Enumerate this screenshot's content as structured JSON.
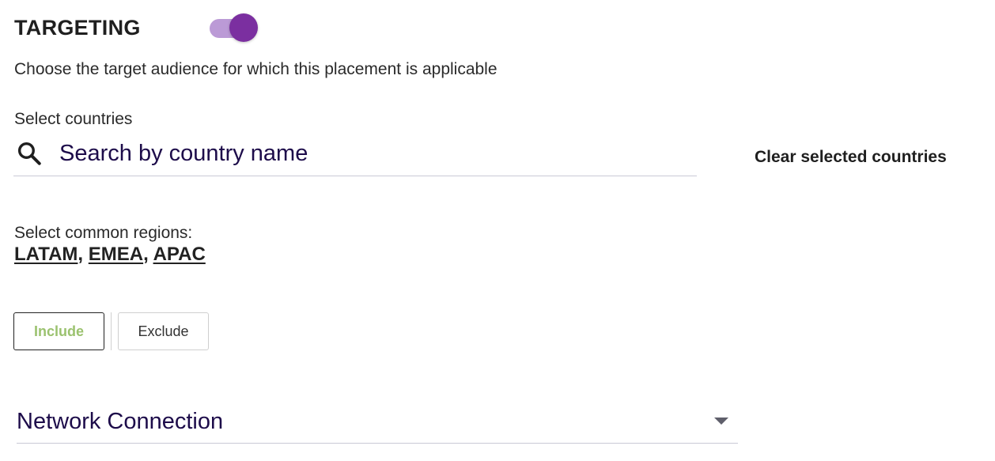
{
  "targeting": {
    "title": "TARGETING",
    "enabled": true,
    "toggle_color": "#7b2fa0",
    "description": "Choose the target audience for which this placement is applicable"
  },
  "countries": {
    "label": "Select countries",
    "search_placeholder": "Search by country name",
    "search_icon": "search-icon",
    "clear_label": "Clear selected countries"
  },
  "regions": {
    "label": "Select common regions:",
    "items": [
      "LATAM",
      "EMEA",
      "APAC"
    ],
    "separator": ", "
  },
  "mode": {
    "include_label": "Include",
    "exclude_label": "Exclude",
    "selected": "Include",
    "include_text_color": "#9bc26f"
  },
  "network": {
    "label": "Network Connection",
    "arrow_icon": "chevron-down-icon"
  }
}
